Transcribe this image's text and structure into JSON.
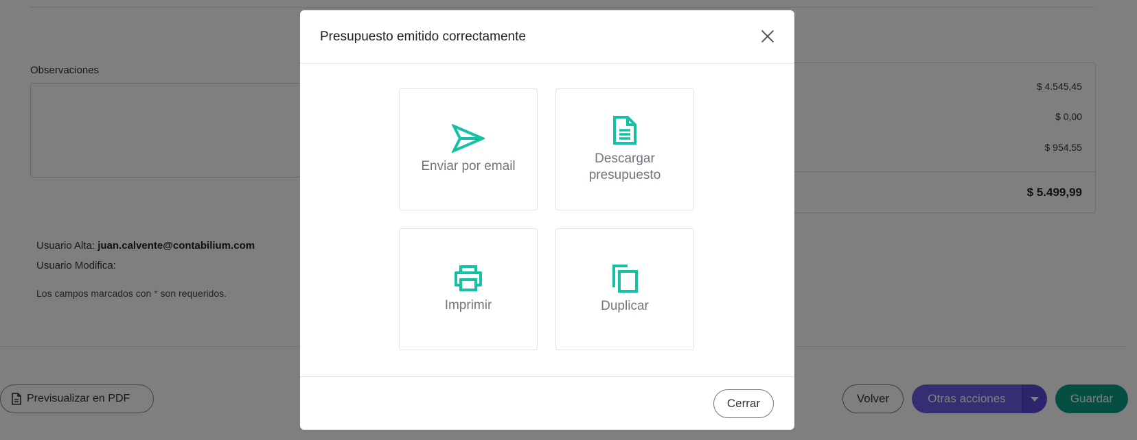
{
  "form": {
    "observations_label": "Observaciones",
    "subtotal": "$ 4.545,45",
    "discount": "$ 0,00",
    "tax": "$ 954,55",
    "total": "$ 5.499,99",
    "user_created_label": "Usuario Alta:",
    "user_created_value": "juan.calvente@contabilium.com",
    "user_modified_label": "Usuario Modifica:",
    "required_note_prefix": "Los campos marcados con",
    "required_star": "*",
    "required_note_suffix": "son requeridos."
  },
  "footer": {
    "preview_pdf_label": "Previsualizar en PDF",
    "back_label": "Volver",
    "other_actions_label": "Otras acciones",
    "save_label": "Guardar"
  },
  "modal": {
    "title": "Presupuesto emitido correctamente",
    "actions": [
      {
        "label": "Enviar por email",
        "icon": "send-icon"
      },
      {
        "label": "Descargar\npresupuesto",
        "icon": "document-icon"
      },
      {
        "label": "Imprimir",
        "icon": "printer-icon"
      },
      {
        "label": "Duplicar",
        "icon": "copy-icon"
      }
    ],
    "close_label": "Cerrar"
  },
  "colors": {
    "accent": "#14c2a3",
    "primary_purple": "#6b5ce7",
    "save_green": "#0b9f85"
  }
}
